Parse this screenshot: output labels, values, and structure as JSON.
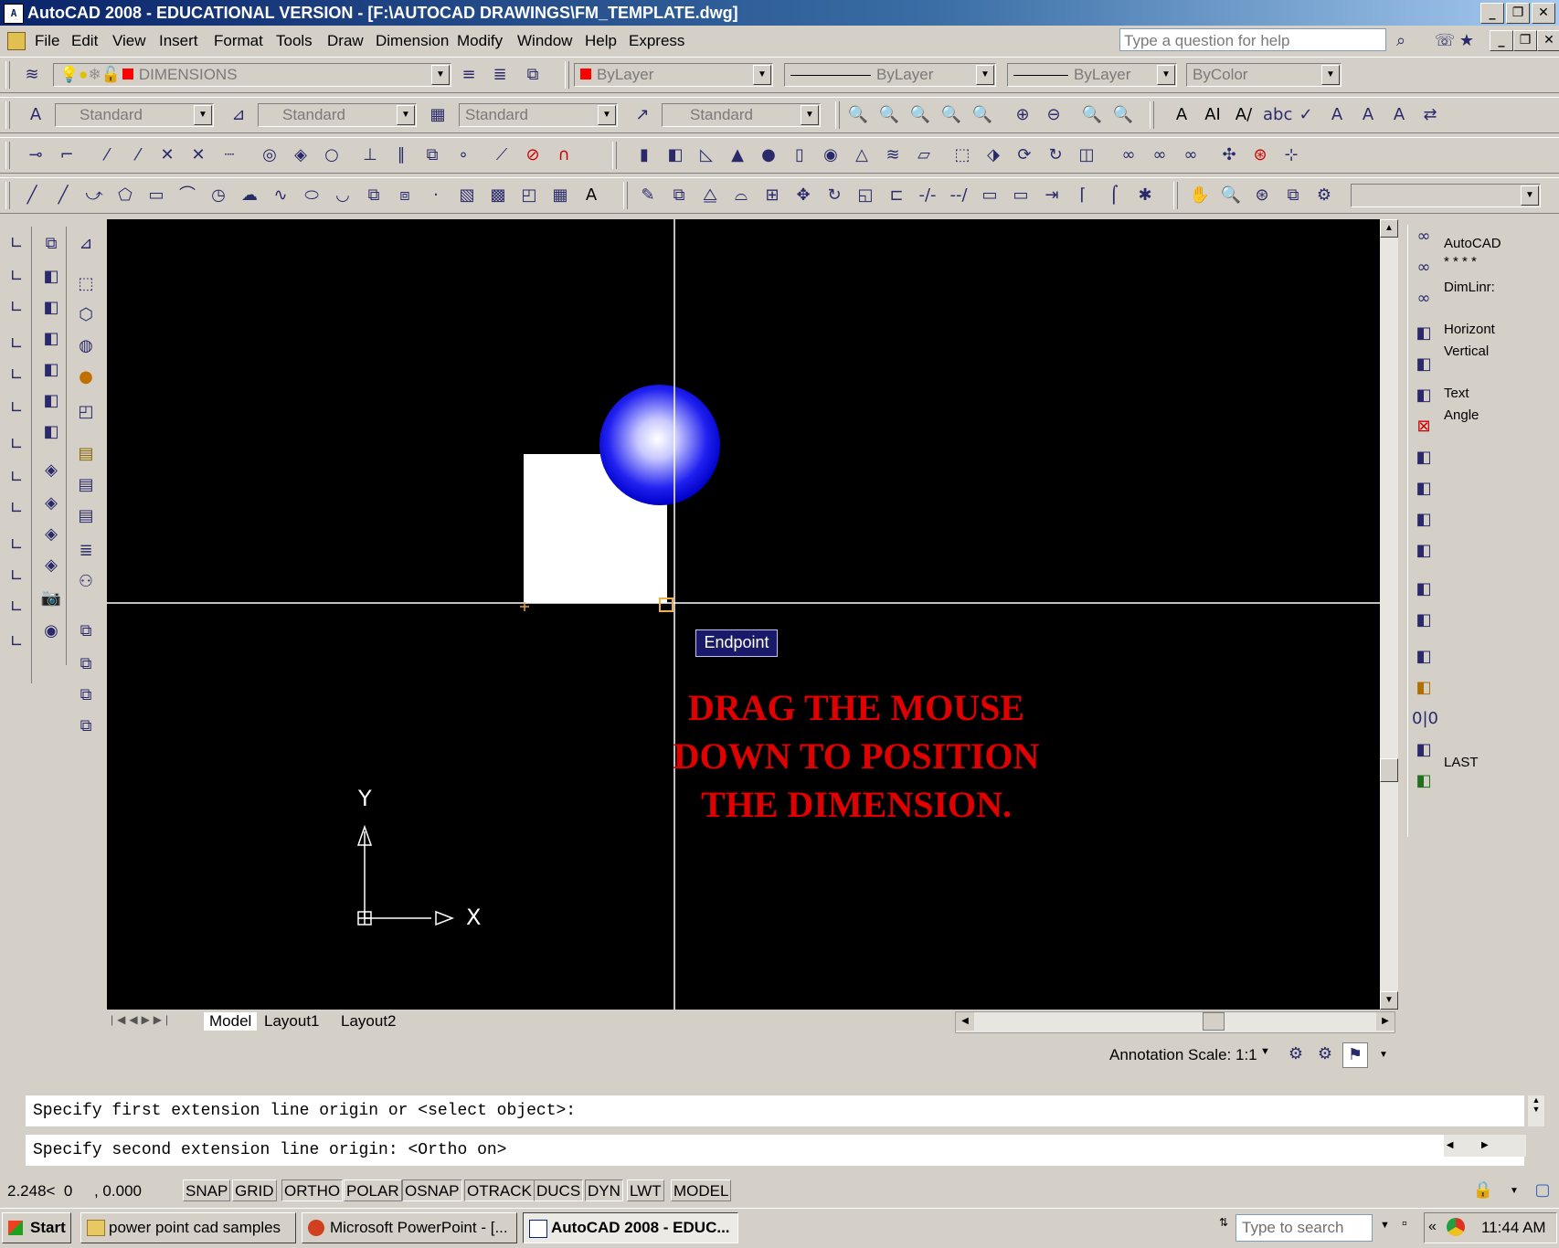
{
  "window": {
    "title": "AutoCAD 2008 - EDUCATIONAL VERSION - [F:\\AUTOCAD DRAWINGS\\FM_TEMPLATE.dwg]",
    "app_icon": "autocad-icon"
  },
  "menu": [
    "File",
    "Edit",
    "View",
    "Insert",
    "Format",
    "Tools",
    "Draw",
    "Dimension",
    "Modify",
    "Window",
    "Help",
    "Express"
  ],
  "help": {
    "placeholder": "Type a question for help"
  },
  "properties_toolbar": {
    "layer": "DIMENSIONS",
    "color": "ByLayer",
    "linetype": "ByLayer",
    "lineweight": "ByLayer",
    "plotstyle": "ByColor"
  },
  "styles_toolbar": {
    "text_style": "Standard",
    "dim_style": "Standard",
    "table_style": "Standard",
    "mleader_style": "Standard"
  },
  "drawing": {
    "tooltip": "Endpoint",
    "instruction": [
      "DRAG THE MOUSE",
      "DOWN TO POSITION",
      "THE DIMENSION."
    ],
    "ucs_y": "Y",
    "ucs_x": "X"
  },
  "tabs": [
    "Model",
    "Layout1",
    "Layout2"
  ],
  "annotation": {
    "label": "Annotation Scale:",
    "scale": "1:1"
  },
  "right_panel": {
    "title": "AutoCAD",
    "stars": "* * * *",
    "command": "DimLinr:",
    "options": [
      "Horizont",
      "Vertical",
      "Text",
      "Angle"
    ],
    "last": "LAST"
  },
  "command_line": {
    "line1": "Specify first extension line origin or <select object>:",
    "line2": "Specify second extension line origin:  <Ortho on>"
  },
  "status": {
    "coords": "2.248<  0     , 0.000",
    "toggles": [
      "SNAP",
      "GRID",
      "ORTHO",
      "POLAR",
      "OSNAP",
      "OTRACK",
      "DUCS",
      "DYN",
      "LWT",
      "MODEL"
    ]
  },
  "taskbar": {
    "start": "Start",
    "buttons": [
      "power point cad samples",
      "Microsoft PowerPoint - [...",
      "AutoCAD 2008 - EDUC..."
    ],
    "search_placeholder": "Type to search",
    "time": "11:44 AM"
  },
  "colors": {
    "title_bar": "#0a246a",
    "instruction": "#e00000",
    "canvas": "#000000",
    "sphere": "#1010e0"
  }
}
